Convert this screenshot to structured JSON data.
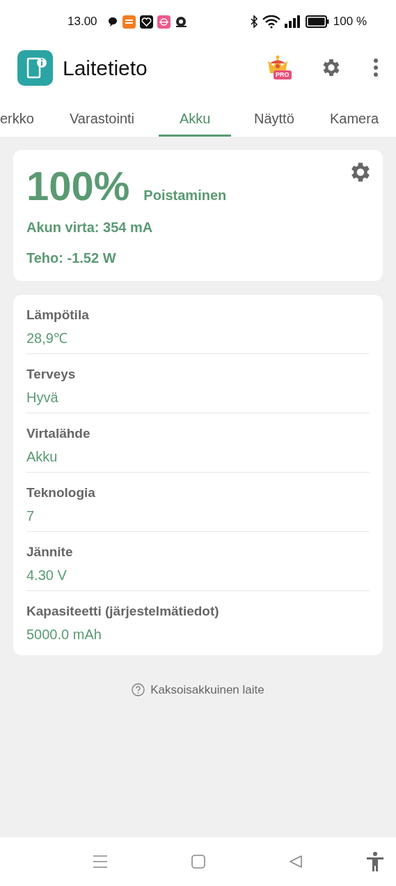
{
  "status_bar": {
    "time": "13.00",
    "battery_text": "100 %"
  },
  "app_bar": {
    "title": "Laitetieto",
    "pro_badge": "PRO"
  },
  "tabs": [
    {
      "label": "erkko",
      "selected": false
    },
    {
      "label": "Varastointi",
      "selected": false
    },
    {
      "label": "Akku",
      "selected": true
    },
    {
      "label": "Näyttö",
      "selected": false
    },
    {
      "label": "Kamera",
      "selected": false
    }
  ],
  "summary": {
    "percent": "100%",
    "status": "Poistaminen",
    "current": "Akun virta: 354 mA",
    "power": "Teho: -1.52 W"
  },
  "details": [
    {
      "label": "Lämpötila",
      "value": "28,9℃"
    },
    {
      "label": "Terveys",
      "value": "Hyvä"
    },
    {
      "label": "Virtalähde",
      "value": "Akku"
    },
    {
      "label": "Teknologia",
      "value": "7"
    },
    {
      "label": "Jännite",
      "value": "4.30 V"
    },
    {
      "label": "Kapasiteetti (järjestelmätiedot)",
      "value": "5000.0 mAh"
    }
  ],
  "footer_link": "Kaksoisakkuinen laite"
}
